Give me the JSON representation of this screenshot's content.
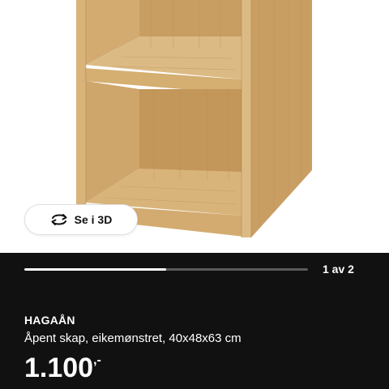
{
  "image": {
    "subject": "open wooden cabinet, oak veneer",
    "colors": {
      "wood_light": "#d9b47a",
      "wood_mid": "#c99e63",
      "wood_dark": "#b88a4f",
      "wood_shadow": "#a47a42"
    }
  },
  "view3d": {
    "label": "Se i 3D",
    "icon": "rotate-3d-icon"
  },
  "gallery": {
    "pager_text": "1 av 2",
    "progress_fraction": 0.5
  },
  "product": {
    "name": "HAGAÅN",
    "description": "Åpent skap, eikemønstret, 40x48x63 cm",
    "price_integer": "1.100",
    "price_suffix": ",-"
  }
}
